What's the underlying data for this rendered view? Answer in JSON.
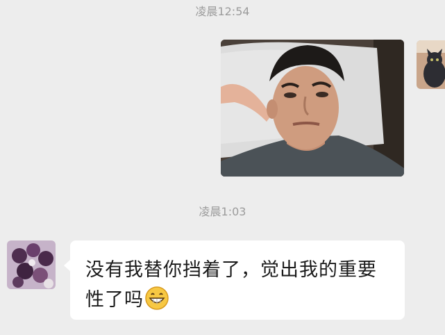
{
  "chat": {
    "messages": [
      {
        "type": "timestamp",
        "text": "凌晨12:54"
      },
      {
        "type": "image",
        "sender": "self",
        "image_icon": "selfie-photo"
      },
      {
        "type": "timestamp",
        "text": "凌晨1:03"
      },
      {
        "type": "text",
        "sender": "other",
        "text": "没有我替你挡着了，觉出我的重要性了吗",
        "emoji": "grinning-face-icon"
      }
    ]
  },
  "colors": {
    "background": "#ededed",
    "bubble_incoming": "#ffffff",
    "timestamp_text": "#9b9b9b"
  }
}
